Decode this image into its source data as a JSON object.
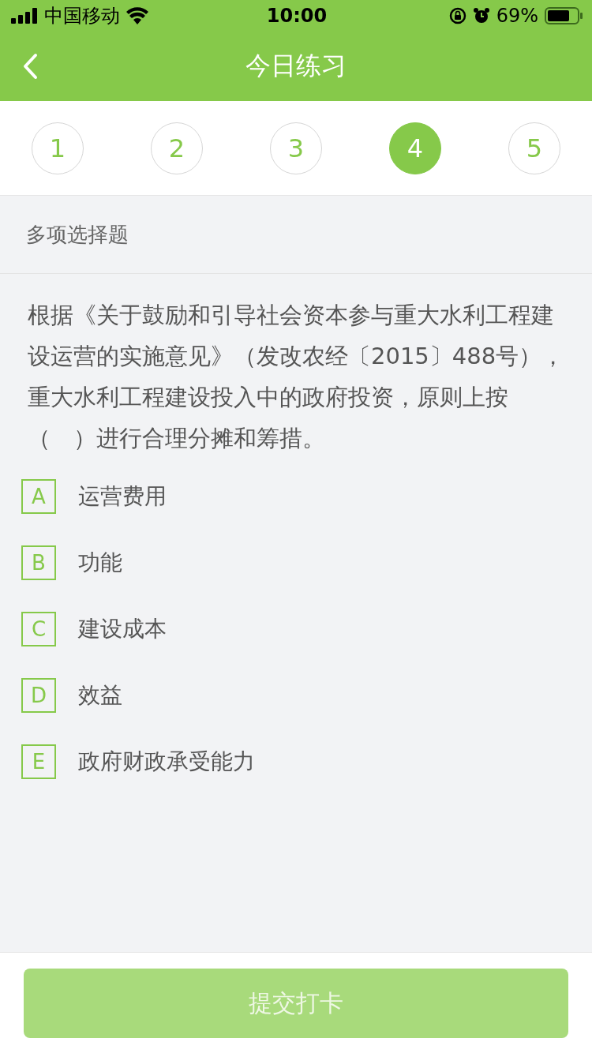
{
  "status_bar": {
    "carrier": "中国移动",
    "time": "10:00",
    "battery": "69%"
  },
  "nav": {
    "title": "今日练习"
  },
  "tabs": [
    {
      "label": "1",
      "selected": false
    },
    {
      "label": "2",
      "selected": false
    },
    {
      "label": "3",
      "selected": false
    },
    {
      "label": "4",
      "selected": true
    },
    {
      "label": "5",
      "selected": false
    }
  ],
  "question_type": "多项选择题",
  "question": "根据《关于鼓励和引导社会资本参与重大水利工程建设运营的实施意见》（发改农经〔2015〕488号），重大水利工程建设投入中的政府投资，原则上按（　）进行合理分摊和筹措。",
  "options": [
    {
      "letter": "A",
      "text": "运营费用",
      "selected": false
    },
    {
      "letter": "B",
      "text": "功能",
      "selected": false
    },
    {
      "letter": "C",
      "text": "建设成本",
      "selected": false
    },
    {
      "letter": "D",
      "text": "效益",
      "selected": false
    },
    {
      "letter": "E",
      "text": "政府财政承受能力",
      "selected": false
    }
  ],
  "submit": {
    "label": "提交打卡",
    "disabled": true
  }
}
